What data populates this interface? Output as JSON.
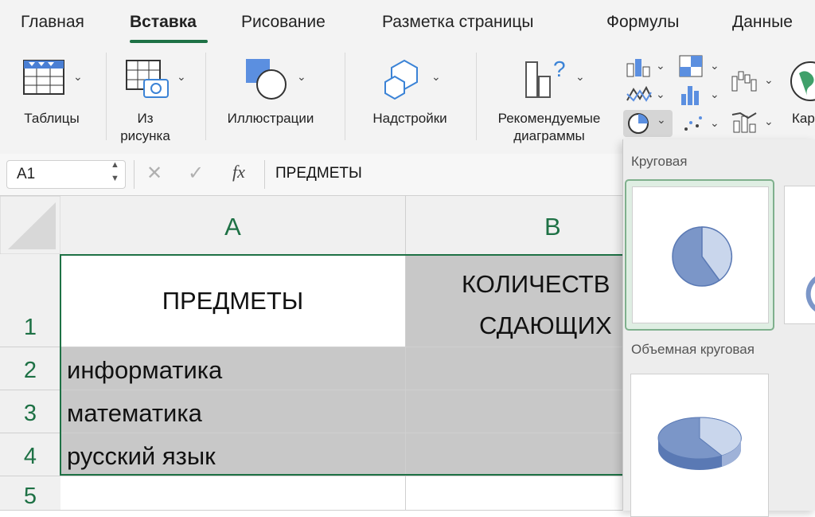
{
  "ribbon_tabs": [
    "Главная",
    "Вставка",
    "Рисование",
    "Разметка страницы",
    "Формулы",
    "Данные"
  ],
  "ribbon_groups": {
    "tables": "Таблицы",
    "from_picture_line1": "Из",
    "from_picture_line2": "рисунка",
    "illustrations": "Иллюстрации",
    "addins": "Надстройки",
    "recommended_line1": "Рекомендуемые",
    "recommended_line2": "диаграммы",
    "maps_partial": "Кар"
  },
  "formula_bar": {
    "cell_ref": "A1",
    "fx": "fx",
    "content": "ПРЕДМЕТЫ"
  },
  "columns": [
    "A",
    "B"
  ],
  "rows": [
    "1",
    "2",
    "3",
    "4",
    "5"
  ],
  "cells": {
    "a1": "ПРЕДМЕТЫ",
    "b1_line1": "КОЛИЧЕСТВ",
    "b1_line2": "СДАЮЩИХ",
    "a2": "информатика",
    "a3": "математика",
    "a4": "русский язык"
  },
  "chart_menu": {
    "section1": "Круговая",
    "section2": "Объемная круговая"
  },
  "colors": {
    "accent": "#1e7145",
    "pie_dark": "#7b96c8",
    "pie_light": "#c9d6ec"
  }
}
